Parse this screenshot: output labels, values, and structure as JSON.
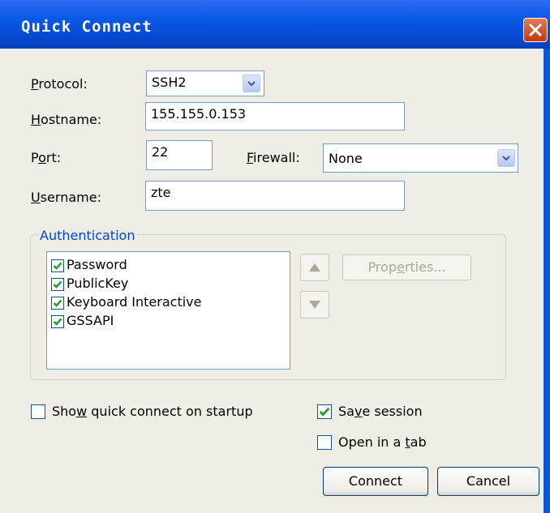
{
  "window": {
    "title": "Quick Connect"
  },
  "protocol": {
    "label_pre": "",
    "label_key": "P",
    "label_post": "rotocol:",
    "value": "SSH2"
  },
  "hostname": {
    "label_pre": "",
    "label_key": "H",
    "label_post": "ostname:",
    "value": "155.155.0.153"
  },
  "port": {
    "label_pre": "P",
    "label_key": "o",
    "label_post": "rt:",
    "value": "22"
  },
  "firewall": {
    "label_pre": "",
    "label_key": "F",
    "label_post": "irewall:",
    "value": "None"
  },
  "username": {
    "label_pre": "",
    "label_key": "U",
    "label_post": "sername:",
    "value": "zte"
  },
  "authentication": {
    "title": "Authentication",
    "methods": [
      {
        "label": "Password",
        "checked": true
      },
      {
        "label": "PublicKey",
        "checked": true
      },
      {
        "label": "Keyboard Interactive",
        "checked": true
      },
      {
        "label": "GSSAPI",
        "checked": true
      }
    ],
    "properties_pre": "Prop",
    "properties_key": "e",
    "properties_post": "rties..."
  },
  "options": {
    "show_pre": "Sho",
    "show_key": "w",
    "show_post": " quick connect on startup",
    "show_checked": false,
    "save_pre": "Sa",
    "save_key": "v",
    "save_post": "e session",
    "save_checked": true,
    "tab_pre": "Open in a ",
    "tab_key": "t",
    "tab_post": "ab",
    "tab_checked": false
  },
  "buttons": {
    "connect": "Connect",
    "cancel": "Cancel"
  },
  "colors": {
    "title_bar": "#0a58e6",
    "group_title": "#0046d5",
    "check_mark": "#21a121"
  }
}
